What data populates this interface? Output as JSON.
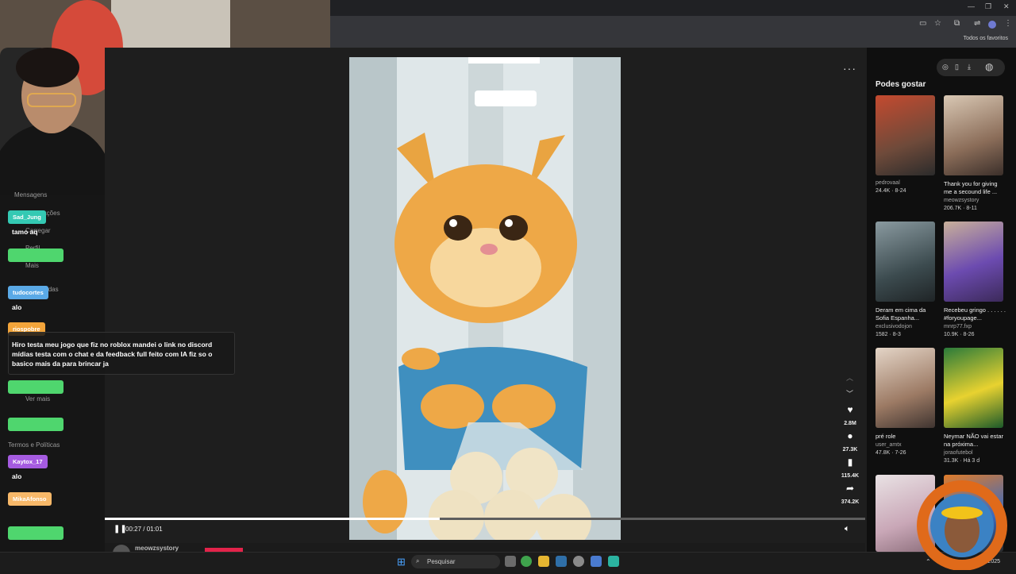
{
  "browser": {
    "bookmarks_label": "Todos os favoritos"
  },
  "nav": {
    "items": [
      "Mensagens",
      "Notificações",
      "Carregar",
      "Perfil",
      "Mais",
      "Contas seguidas",
      "Ver mais",
      "Termos e Políticas"
    ]
  },
  "chat": {
    "messages": [
      {
        "user": "Sad_Jung",
        "color": "#34c9b3",
        "text": "tamo aq"
      },
      {
        "user": "",
        "color": "#4fd66e",
        "text": ""
      },
      {
        "user": "tudocortes",
        "color": "#5aa9e6",
        "text": "alo"
      },
      {
        "user": "riospobre",
        "color": "#f2a43a",
        "text": "Hiro testa meu jogo que fiz no roblox mandei o link no discord mídias testa com o chat e da feedback full feito com IA fiz so o basico mais da para brincar ja"
      },
      {
        "user": "",
        "color": "#4fd66e",
        "text": ""
      },
      {
        "user": "",
        "color": "#4fd66e",
        "text": ""
      },
      {
        "user": "Kaytox_17",
        "color": "#a55be0",
        "text": "alo"
      },
      {
        "user": "MikaAfonso",
        "color": "#f7b869",
        "text": ""
      },
      {
        "user": "",
        "color": "#4fd66e",
        "text": ""
      }
    ]
  },
  "player": {
    "time": "00:27 / 01:01",
    "progress": 0.44,
    "author": "meowzsystory",
    "actions": [
      {
        "icon": "heart-icon",
        "count": "2.8M"
      },
      {
        "icon": "comment-icon",
        "count": "27.3K"
      },
      {
        "icon": "bookmark-icon",
        "count": "115.4K"
      },
      {
        "icon": "share-icon",
        "count": "374.2K"
      }
    ]
  },
  "recommendations": {
    "title": "Podes gostar",
    "items": [
      {
        "caption": "",
        "user": "pedrovaal",
        "stats": "24.4K · 8-24"
      },
      {
        "caption": "Thank you for giving me a secound life ...",
        "user": "meowzsystory",
        "stats": "206.7K · 8-11"
      },
      {
        "caption": "Deram em cima da Sofia Espanha...",
        "user": "exclusivodojon",
        "stats": "1582 · 8-3"
      },
      {
        "caption": "Recebeu gringo . . . . . . #foryoupage...",
        "user": "mnrp77.fxp",
        "stats": "10.9K · 8-26"
      },
      {
        "caption": "pré role",
        "user": "user_amtx",
        "stats": "47.8K · 7-26"
      },
      {
        "caption": "Neymar NÃO vai estar na próxima...",
        "user": "joraofutebol",
        "stats": "31.3K · Há 3 d"
      },
      {
        "caption": "",
        "user": "",
        "stats": ""
      },
      {
        "caption": "",
        "user": "",
        "stats": ""
      }
    ]
  },
  "taskbar": {
    "search_placeholder": "Pesquisar",
    "tray": "2025"
  },
  "colors": {
    "like_red": "#e3234a",
    "bg_dark": "#1e1e1e"
  }
}
